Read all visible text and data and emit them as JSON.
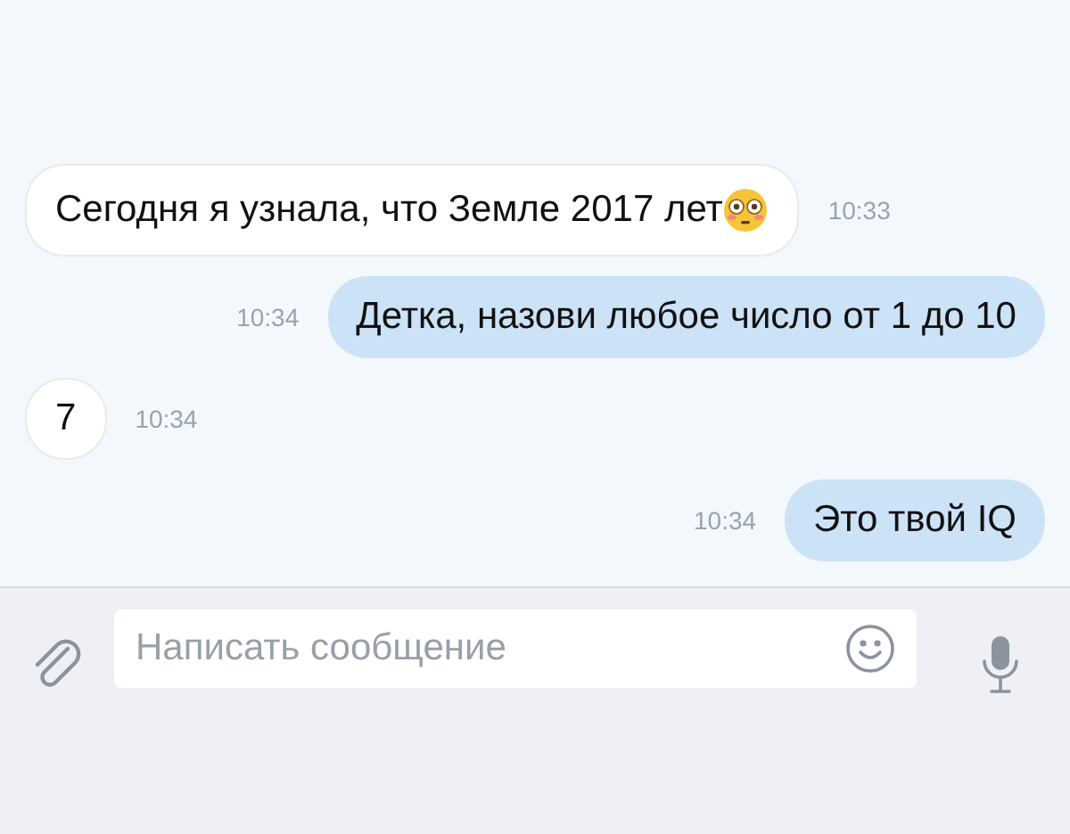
{
  "messages": [
    {
      "kind": "incoming",
      "text": "Сегодня я узнала, что Земле 2017 лет",
      "trailing_emoji": true,
      "time": "10:33"
    },
    {
      "kind": "outgoing",
      "text": "Детка, назови любое число от 1 до 10",
      "trailing_emoji": false,
      "time": "10:34"
    },
    {
      "kind": "incoming",
      "text": "7",
      "trailing_emoji": false,
      "time": "10:34"
    },
    {
      "kind": "outgoing",
      "text": "Это твой IQ",
      "trailing_emoji": false,
      "time": "10:34"
    }
  ],
  "composer": {
    "placeholder": "Написать сообщение"
  }
}
